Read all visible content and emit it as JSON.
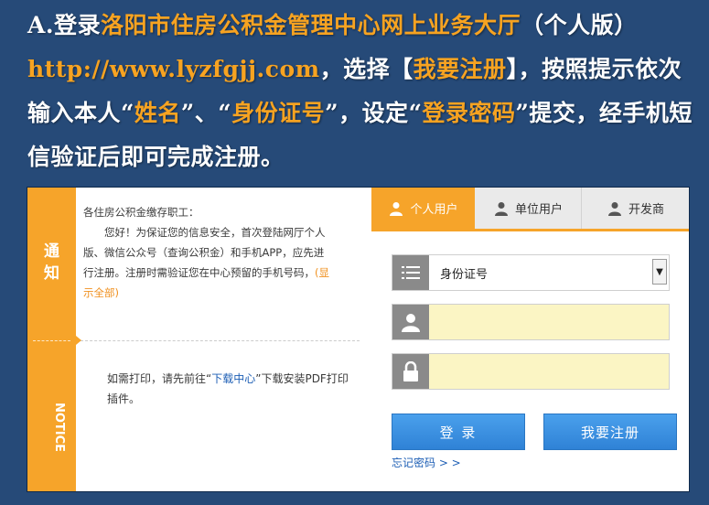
{
  "instruction": {
    "prefix": "A.登录",
    "site_name": "洛阳市住房公积金管理中心网上业务大厅",
    "edition": "（个人版）",
    "url": "http://www.lyzfgjj.com",
    "select_text": "，选择【",
    "register_label": "我要注册",
    "after_register": "】，按照提示依次输入本人“",
    "name_label": "姓名",
    "sep1": "”、“",
    "id_label": "身份证号",
    "sep2": "”，设定“",
    "password_label": "登录密码",
    "sep3": "”提交，经手机短信验证后即可完成注册。"
  },
  "left_tab": {
    "tong": "通",
    "zhi": "知",
    "notice": "NOTICE"
  },
  "notice": {
    "greeting": "各住房公积金缴存职工：",
    "body": "您好！为保证您的信息安全，首次登陆网厅个人版、微信公众号（查询公积金）和手机APP，应先进行注册。注册时需验证您在中心预留的手机号码，",
    "show_all": "(显示全部)",
    "print_prefix": "如需打印，请先前往“",
    "download_center": "下载中心",
    "print_suffix": "”下载安装PDF打印插件。"
  },
  "tabs": [
    {
      "label": "个人用户",
      "icon": "personal-user-icon"
    },
    {
      "label": "单位用户",
      "icon": "unit-user-icon"
    },
    {
      "label": "开发商",
      "icon": "developer-icon"
    }
  ],
  "form": {
    "id_type_selected": "身份证号",
    "id_number_value": "",
    "password_value": "",
    "login_button": "登 录",
    "register_button": "我要注册",
    "forgot_password": "忘记密码 > >"
  },
  "colors": {
    "accent": "#f6a42a",
    "background": "#264a78",
    "button": "#3a8ee0",
    "input_fill": "#fbf5c4"
  }
}
